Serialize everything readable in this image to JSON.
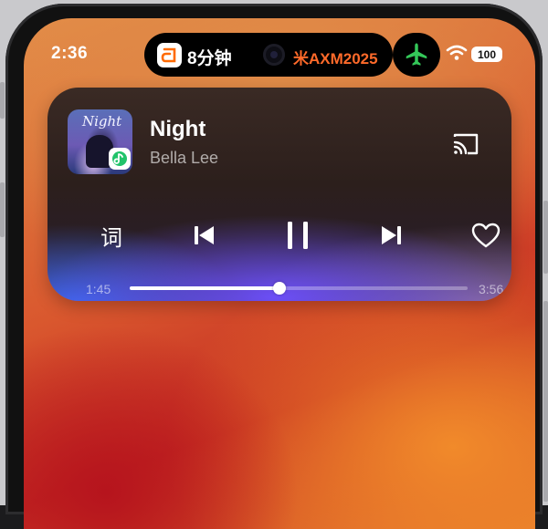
{
  "status_bar": {
    "time": "2:36",
    "island_left_text": "8分钟",
    "island_right_text": "米AXM2025",
    "battery": "100",
    "plane_color": "#34c759",
    "flight_text_color": "#ff6a2a",
    "icons": [
      "didi-app-icon",
      "airplane-icon",
      "wifi-icon",
      "battery-icon"
    ]
  },
  "player": {
    "album_art_text": "Night",
    "song_title": "Night",
    "artist": "Bella Lee",
    "lyrics_label": "词",
    "elapsed": "1:45",
    "total": "3:56",
    "progress_fraction": 0.444,
    "icons": [
      "cast-icon",
      "previous-track-icon",
      "pause-icon",
      "next-track-icon",
      "heart-icon",
      "music-app-badge-icon"
    ]
  }
}
